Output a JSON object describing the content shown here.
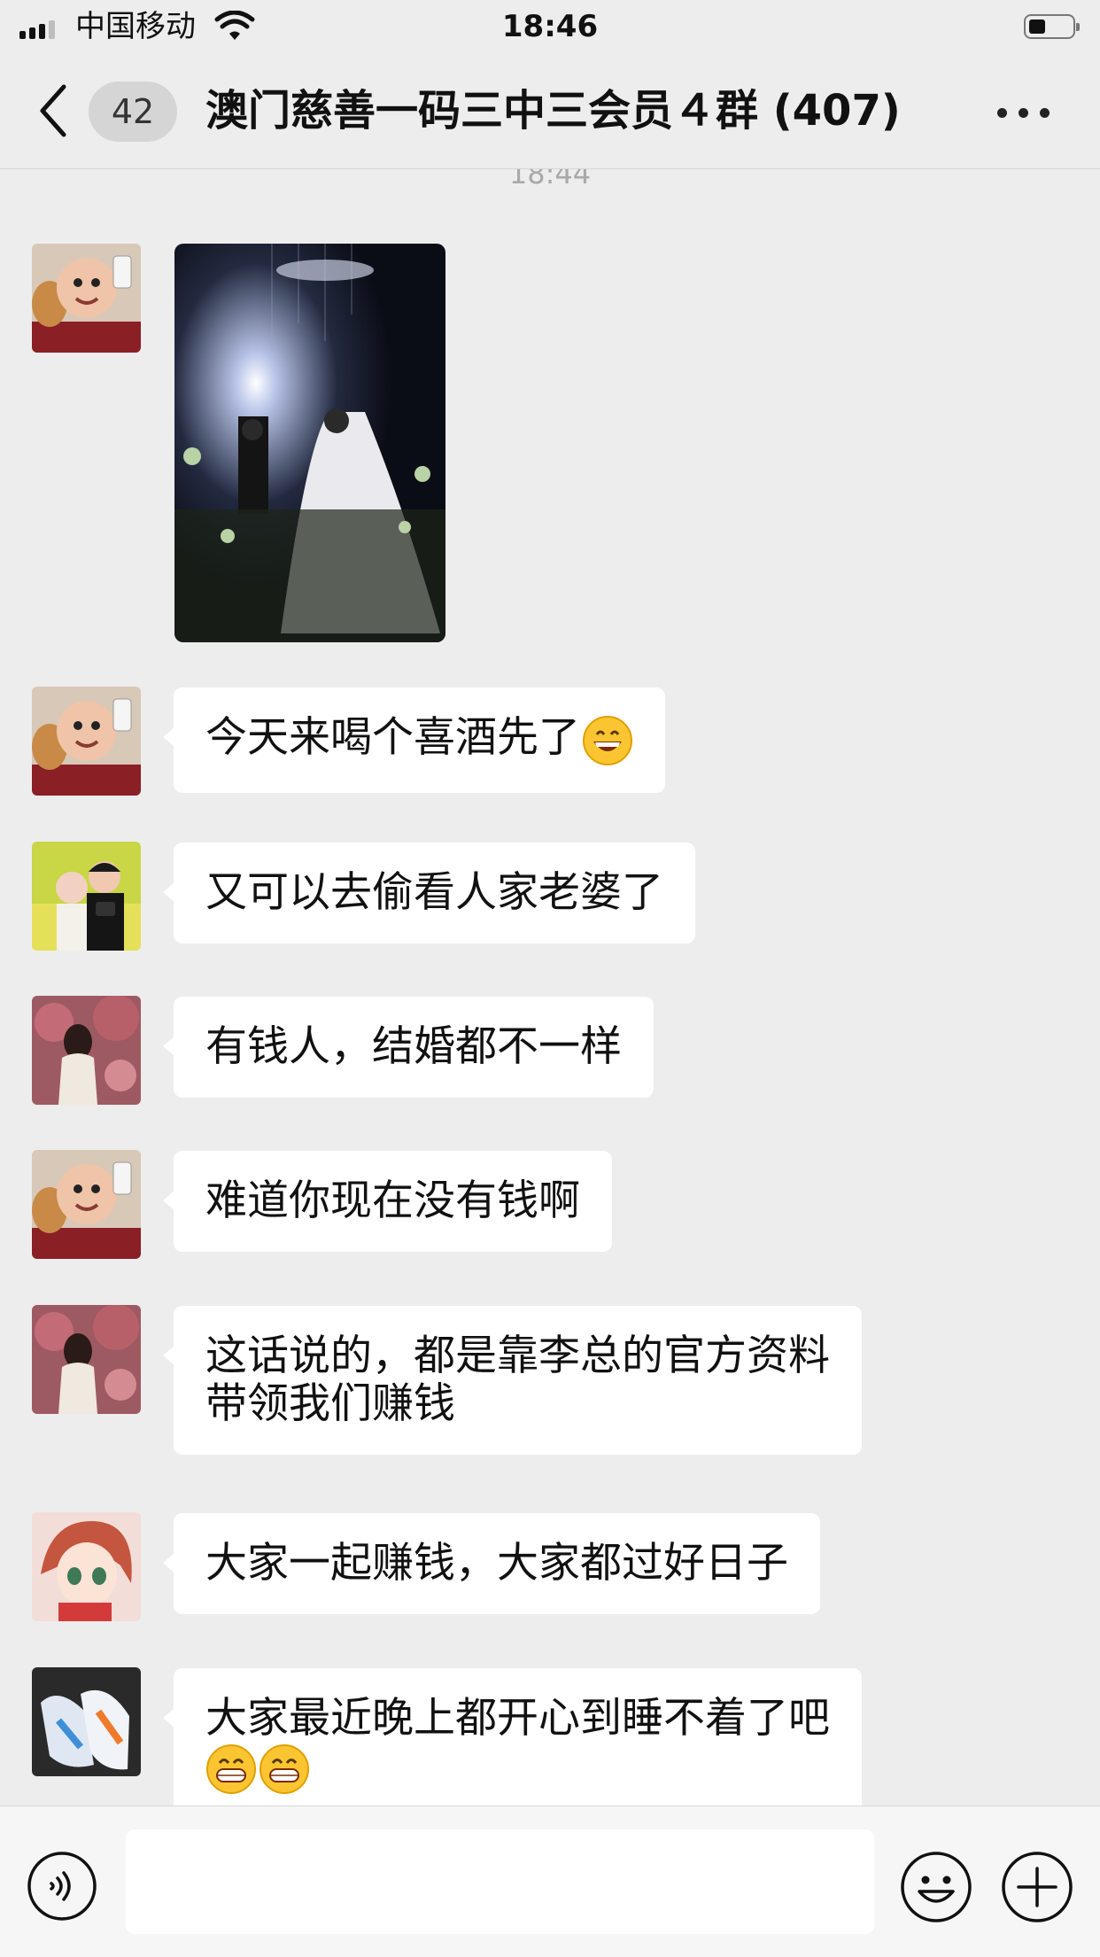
{
  "status_bar": {
    "carrier": "中国移动",
    "time": "18:46",
    "signal_icon": "signal-bars-icon",
    "wifi_icon": "wifi-icon",
    "battery_icon": "battery-icon",
    "battery_level": 0.35
  },
  "header": {
    "unread_count": "42",
    "title": "澳门慈善一码三中三会员４群 (407)",
    "back_icon": "chevron-left-icon",
    "more_icon": "more-dots-icon"
  },
  "time_separator": "18:44",
  "messages": [
    {
      "sender_avatar": "baby-selfie-avatar",
      "type": "image",
      "image_icon": "wedding-photo"
    },
    {
      "sender_avatar": "baby-selfie-avatar",
      "type": "text",
      "text": "今天来喝个喜酒先了",
      "emoji": "grinning-emoji"
    },
    {
      "sender_avatar": "couple-flowers-avatar",
      "type": "text",
      "text": "又可以去偷看人家老婆了"
    },
    {
      "sender_avatar": "girl-blossom-avatar",
      "type": "text",
      "text": "有钱人，结婚都不一样"
    },
    {
      "sender_avatar": "baby-selfie-avatar",
      "type": "text",
      "text": "难道你现在没有钱啊"
    },
    {
      "sender_avatar": "girl-blossom-avatar",
      "type": "text",
      "lines": [
        "这话说的，都是靠李总的官方资料",
        "带领我们赚钱"
      ]
    },
    {
      "sender_avatar": "anime-girl-avatar",
      "type": "text",
      "text": "大家一起赚钱，大家都过好日子"
    },
    {
      "sender_avatar": "sneakers-avatar",
      "type": "text",
      "text": "大家最近晚上都开心到睡不着了吧",
      "emoji": "grin-emoji"
    }
  ],
  "input_bar": {
    "voice_icon": "voice-icon",
    "input_value": "",
    "emoji_icon": "smiley-icon",
    "plus_icon": "plus-icon"
  },
  "colors": {
    "background": "#ededed",
    "bubble": "#ffffff",
    "text": "#111111",
    "timestamp": "#a9a9a9"
  }
}
